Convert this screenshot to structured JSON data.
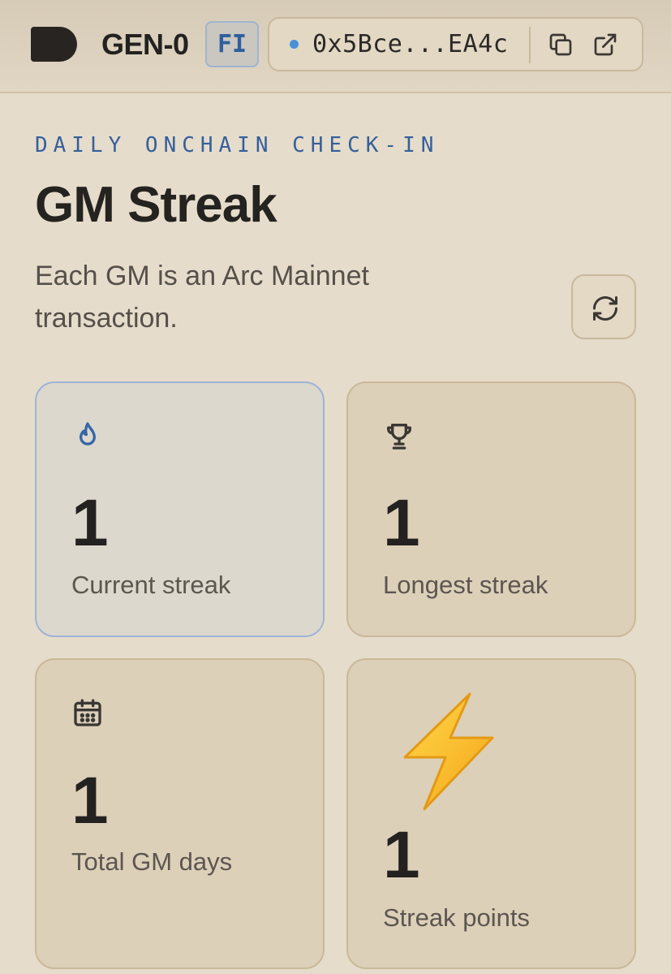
{
  "header": {
    "brand": "GEN-0",
    "lang_label": "FI",
    "wallet": {
      "address": "0x5Bce...EA4c",
      "status_color": "#4a90d9",
      "copy_icon": "copy-icon",
      "external_icon": "external-link-icon"
    }
  },
  "page": {
    "kicker": "DAILY ONCHAIN CHECK-IN",
    "title": "GM Streak",
    "subtitle": "Each GM is an Arc Mainnet transaction.",
    "refresh_icon": "refresh-icon"
  },
  "stats": {
    "current": {
      "value": "1",
      "label": "Current streak",
      "icon": "flame-icon"
    },
    "longest": {
      "value": "1",
      "label": "Longest streak",
      "icon": "trophy-icon"
    },
    "total": {
      "value": "1",
      "label": "Total GM days",
      "icon": "calendar-icon"
    },
    "points": {
      "value": "1",
      "label": "Streak points",
      "icon": "lightning-icon"
    }
  },
  "colors": {
    "accent": "#35609a",
    "background": "#e6dccb",
    "card": "#ddd0b9",
    "active_card": "#dcd8cd"
  }
}
